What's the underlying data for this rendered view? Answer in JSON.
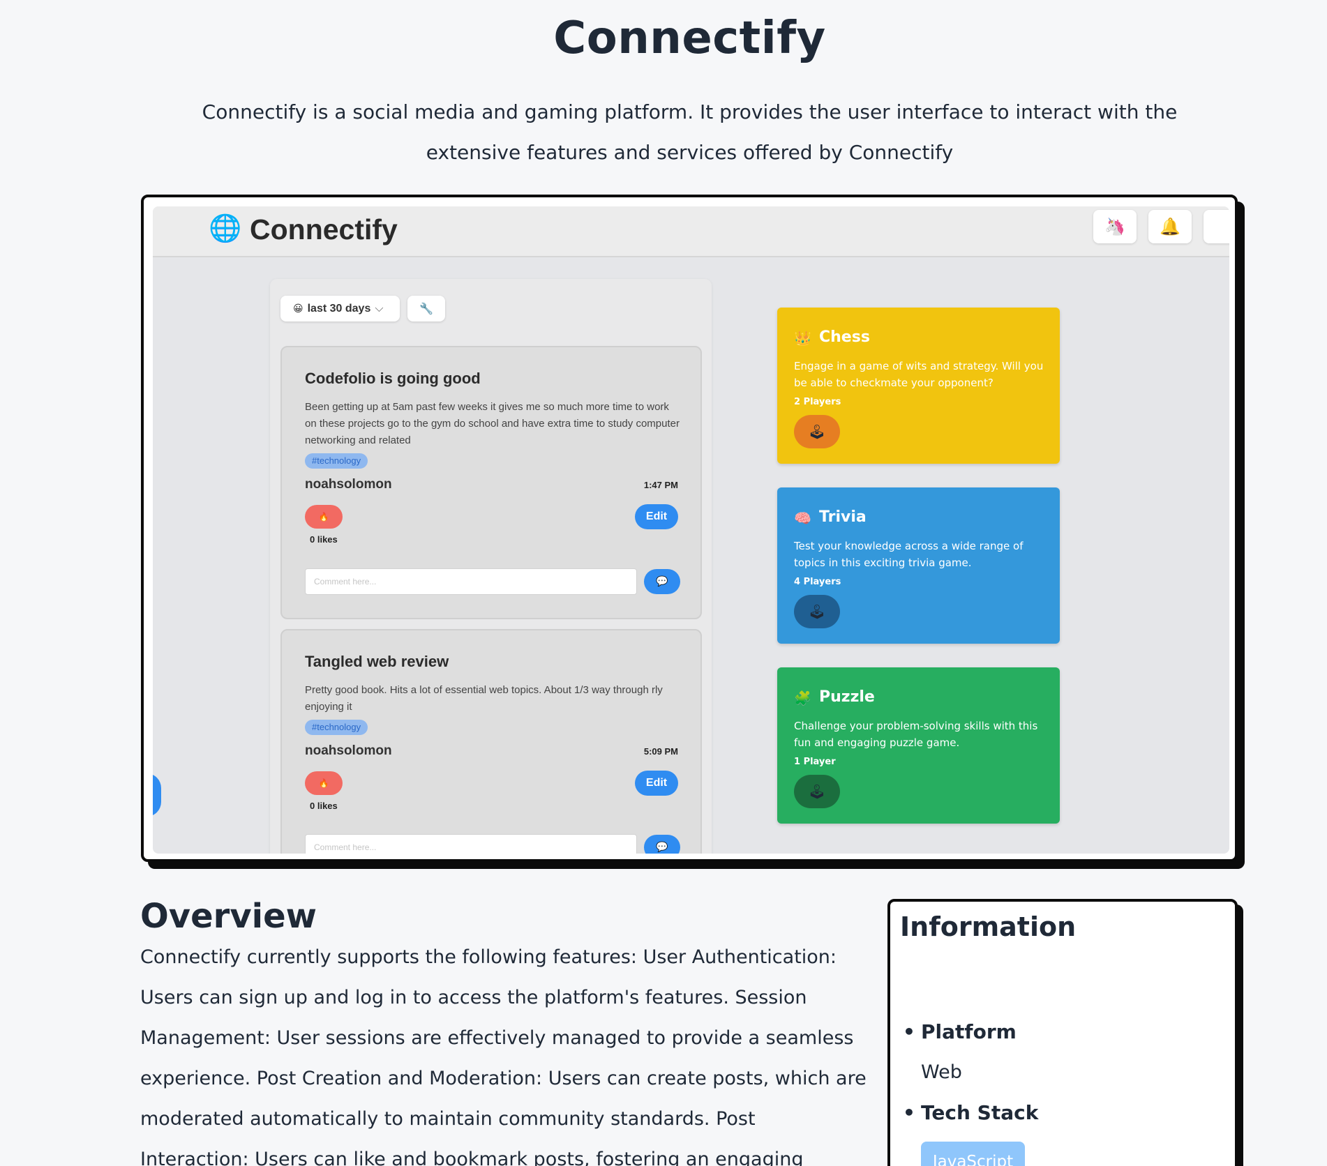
{
  "page": {
    "title": "Connectify",
    "description": "Connectify is a social media and gaming platform. It provides the user interface to interact with the extensive features and services offered by Connectify"
  },
  "app": {
    "brand": "Connectify",
    "logo_icon": "globe-icon",
    "nav_buttons": [
      {
        "icon": "unicorn-icon",
        "glyph": "🦄"
      },
      {
        "icon": "bell-icon",
        "glyph": "🔔"
      }
    ],
    "filter": {
      "icon": "face-icon",
      "glyph": "😀",
      "label": "last 30 days",
      "chevron": "⌵"
    },
    "tool_glyph": "🔧",
    "posts": [
      {
        "title": "Codefolio is going good",
        "body": "Been getting up at 5am past few weeks it gives me so much more time to work on these projects go to the gym do school and have extra time to study computer networking and related",
        "tag": "#technology",
        "author": "noahsolomon",
        "time": "1:47 PM",
        "likes": "0 likes",
        "like_glyph": "🔥",
        "edit_label": "Edit",
        "comment_placeholder": "Comment here...",
        "send_glyph": "💬"
      },
      {
        "title": "Tangled web review",
        "body": "Pretty good book. Hits a lot of essential web topics. About 1/3 way through rly enjoying it",
        "tag": "#technology",
        "author": "noahsolomon",
        "time": "5:09 PM",
        "likes": "0 likes",
        "like_glyph": "🔥",
        "edit_label": "Edit",
        "comment_placeholder": "Comment here...",
        "send_glyph": "💬"
      }
    ],
    "games": [
      {
        "name": "Chess",
        "icon": "crown-icon",
        "glyph": "👑",
        "description": "Engage in a game of wits and strategy. Will you be able to checkmate your opponent?",
        "players": "2 Players",
        "play_glyph": "🕹",
        "color": "#f1c40f",
        "button_color": "#e67e22"
      },
      {
        "name": "Trivia",
        "icon": "brain-icon",
        "glyph": "🧠",
        "description": "Test your knowledge across a wide range of topics in this exciting trivia game.",
        "players": "4 Players",
        "play_glyph": "🕹",
        "color": "#3498db",
        "button_color": "#1f5f92"
      },
      {
        "name": "Puzzle",
        "icon": "puzzle-icon",
        "glyph": "🧩",
        "description": "Challenge your problem-solving skills with this fun and engaging puzzle game.",
        "players": "1 Player",
        "play_glyph": "🕹",
        "color": "#27ae60",
        "button_color": "#1b6e3e"
      }
    ]
  },
  "overview": {
    "title": "Overview",
    "body": "Connectify currently supports the following features: User Authentication: Users can sign up and log in to access the platform's features. Session Management: User sessions are effectively managed to provide a seamless experience. Post Creation and Moderation: Users can create posts, which are moderated automatically to maintain community standards. Post Interaction: Users can like and bookmark posts, fostering an engaging environment."
  },
  "information": {
    "title": "Information",
    "platform_label": "Platform",
    "platform_value": "Web",
    "tech_label": "Tech Stack",
    "tech_items": [
      "JavaScript"
    ],
    "bullet": "•"
  }
}
